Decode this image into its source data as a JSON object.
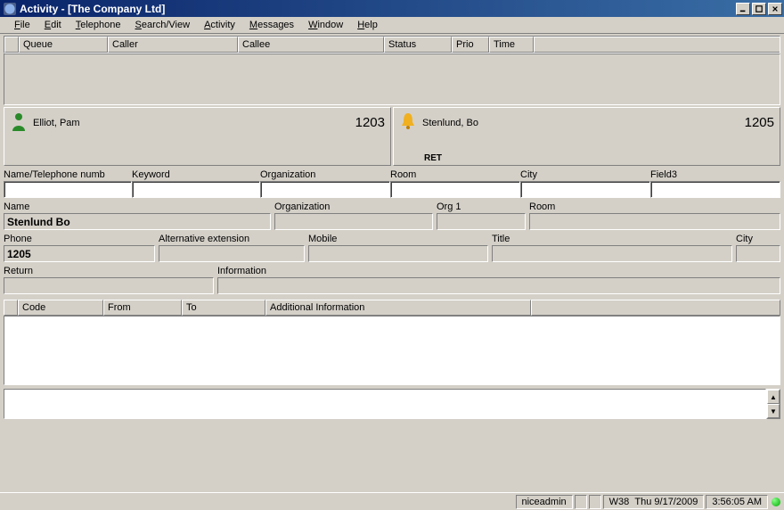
{
  "window": {
    "title": "Activity - [The Company Ltd]"
  },
  "menu": {
    "file": "File",
    "edit": "Edit",
    "telephone": "Telephone",
    "search": "Search/View",
    "activity": "Activity",
    "messages": "Messages",
    "window": "Window",
    "help": "Help"
  },
  "queue_cols": {
    "queue": "Queue",
    "caller": "Caller",
    "callee": "Callee",
    "status": "Status",
    "prio": "Prio",
    "time": "Time"
  },
  "cards": {
    "left": {
      "name": "Elliot, Pam",
      "ext": "1203",
      "status": ""
    },
    "right": {
      "name": "Stenlund, Bo",
      "ext": "1205",
      "status": "RET"
    }
  },
  "search": {
    "name_tel": "Name/Telephone numb",
    "keyword": "Keyword",
    "organization": "Organization",
    "room": "Room",
    "city": "City",
    "field3": "Field3"
  },
  "detail_labels": {
    "name": "Name",
    "organization": "Organization",
    "org1": "Org 1",
    "room": "Room",
    "phone": "Phone",
    "altext": "Alternative extension",
    "mobile": "Mobile",
    "title": "Title",
    "city": "City",
    "return": "Return",
    "information": "Information"
  },
  "detail_values": {
    "name": "Stenlund Bo",
    "organization": "",
    "org1": "",
    "room": "",
    "phone": "1205",
    "altext": "",
    "mobile": "",
    "title": "",
    "city": "",
    "return": "",
    "information": ""
  },
  "info_cols": {
    "code": "Code",
    "from": "From",
    "to": "To",
    "additional": "Additional Information"
  },
  "status": {
    "user": "niceadmin",
    "week": "W38",
    "date": "Thu 9/17/2009",
    "time": "3:56:05 AM"
  }
}
